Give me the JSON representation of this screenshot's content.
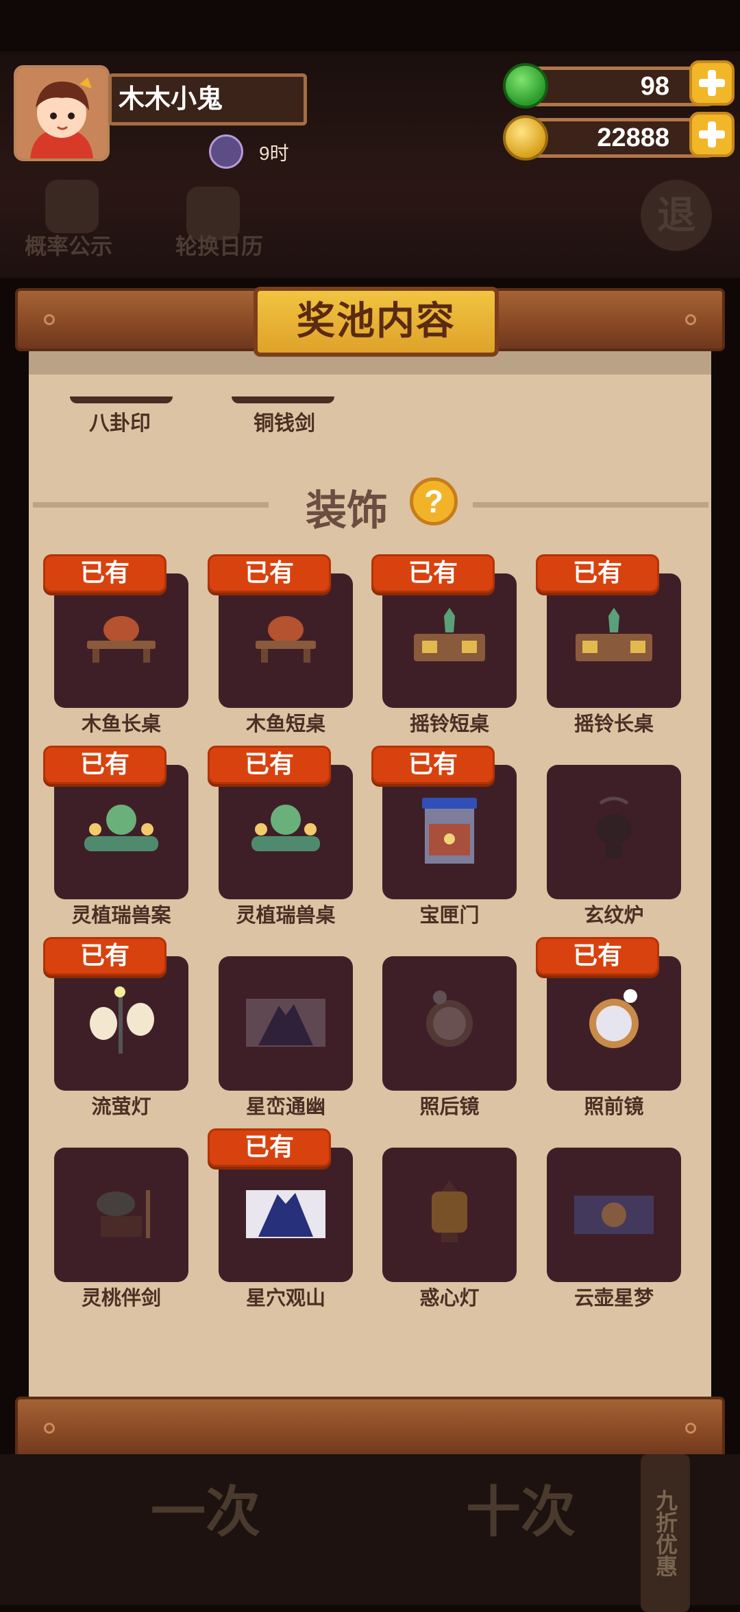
{
  "player": {
    "name": "木木小鬼",
    "status_text": "9时"
  },
  "currency": {
    "jade": "98",
    "coins": "22888"
  },
  "top_buttons": {
    "rates": "概率公示",
    "calendar": "轮换日历",
    "exit": "退"
  },
  "panel": {
    "title": "奖池内容"
  },
  "previous_items": [
    "八卦印",
    "铜钱剑"
  ],
  "section": {
    "title": "装饰",
    "help": "?"
  },
  "owned_label": "已有",
  "items": [
    {
      "name": "木鱼长桌",
      "owned": true
    },
    {
      "name": "木鱼短桌",
      "owned": true
    },
    {
      "name": "摇铃短桌",
      "owned": true
    },
    {
      "name": "摇铃长桌",
      "owned": true
    },
    {
      "name": "灵植瑞兽案",
      "owned": true
    },
    {
      "name": "灵植瑞兽桌",
      "owned": true
    },
    {
      "name": "宝匣门",
      "owned": true
    },
    {
      "name": "玄纹炉",
      "owned": false
    },
    {
      "name": "流萤灯",
      "owned": true
    },
    {
      "name": "星峦通幽",
      "owned": false
    },
    {
      "name": "照后镜",
      "owned": false
    },
    {
      "name": "照前镜",
      "owned": true
    },
    {
      "name": "灵桃伴剑",
      "owned": false
    },
    {
      "name": "星穴观山",
      "owned": true
    },
    {
      "name": "惑心灯",
      "owned": false
    },
    {
      "name": "云壶星梦",
      "owned": false
    }
  ],
  "bottom": {
    "draw_one": "一次",
    "draw_ten": "十次",
    "discount_tab": "九折优惠"
  },
  "colors": {
    "owned_badge": "#d8420e",
    "card_bg": "#3f1f27",
    "parchment": "#dcc3a3",
    "title_plate": "#f1c441"
  }
}
